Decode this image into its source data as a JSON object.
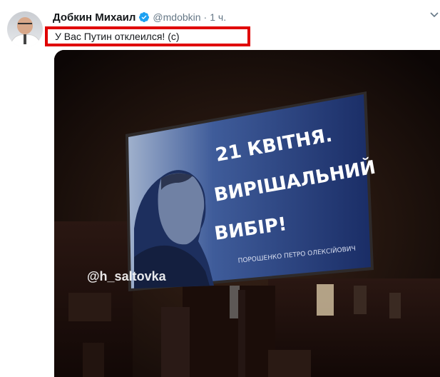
{
  "user": {
    "name": "Добкин Михаил",
    "handle": "@mdobkin",
    "separator": "·",
    "time": "1 ч."
  },
  "tweet": {
    "text": "У Вас Путин отклеился! (с)"
  },
  "media": {
    "billboard_line1": "21 КВІТНЯ.",
    "billboard_line2": "ВИРІШАЛЬНИЙ",
    "billboard_line3": "ВИБІР!",
    "billboard_caption": "ПОРОШЕНКО ПЕТРО ОЛЕКСІЙОВИЧ",
    "watermark": "@h_saltovka"
  },
  "icons": {
    "verified": "verified-badge-icon",
    "caret": "chevron-down-icon"
  },
  "colors": {
    "highlight_border": "#e00000",
    "verified_blue": "#1da1f2"
  }
}
